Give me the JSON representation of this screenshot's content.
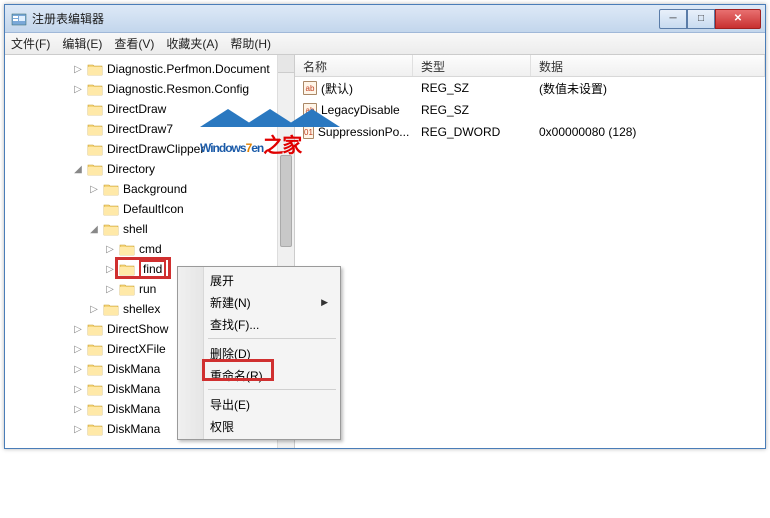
{
  "window": {
    "title": "注册表编辑器"
  },
  "menu": {
    "file": "文件(F)",
    "edit": "编辑(E)",
    "view": "查看(V)",
    "favorites": "收藏夹(A)",
    "help": "帮助(H)"
  },
  "tree": {
    "items": [
      {
        "depth": 3,
        "tw": "▷",
        "label": "Diagnostic.Perfmon.Document"
      },
      {
        "depth": 3,
        "tw": "▷",
        "label": "Diagnostic.Resmon.Config"
      },
      {
        "depth": 3,
        "tw": "",
        "label": "DirectDraw"
      },
      {
        "depth": 3,
        "tw": "",
        "label": "DirectDraw7"
      },
      {
        "depth": 3,
        "tw": "",
        "label": "DirectDrawClipper"
      },
      {
        "depth": 3,
        "tw": "◢",
        "label": "Directory"
      },
      {
        "depth": 4,
        "tw": "▷",
        "label": "Background"
      },
      {
        "depth": 4,
        "tw": "",
        "label": "DefaultIcon"
      },
      {
        "depth": 4,
        "tw": "◢",
        "label": "shell"
      },
      {
        "depth": 5,
        "tw": "▷",
        "label": "cmd"
      },
      {
        "depth": 5,
        "tw": "▷",
        "label": "find",
        "selected": true
      },
      {
        "depth": 5,
        "tw": "▷",
        "label": "run"
      },
      {
        "depth": 4,
        "tw": "▷",
        "label": "shellex"
      },
      {
        "depth": 3,
        "tw": "▷",
        "label": "DirectShow"
      },
      {
        "depth": 3,
        "tw": "▷",
        "label": "DirectXFile"
      },
      {
        "depth": 3,
        "tw": "▷",
        "label": "DiskMana"
      },
      {
        "depth": 3,
        "tw": "▷",
        "label": "DiskMana"
      },
      {
        "depth": 3,
        "tw": "▷",
        "label": "DiskMana"
      },
      {
        "depth": 3,
        "tw": "▷",
        "label": "DiskMana"
      }
    ]
  },
  "list": {
    "headers": {
      "name": "名称",
      "type": "类型",
      "data": "数据"
    },
    "rows": [
      {
        "icon": "ab",
        "name": "(默认)",
        "type": "REG_SZ",
        "data": "(数值未设置)"
      },
      {
        "icon": "ab",
        "name": "LegacyDisable",
        "type": "REG_SZ",
        "data": ""
      },
      {
        "icon": "01",
        "name": "SuppressionPo...",
        "type": "REG_DWORD",
        "data": "0x00000080 (128)"
      }
    ]
  },
  "context_menu": {
    "expand": "展开",
    "new": "新建(N)",
    "find": "查找(F)...",
    "delete": "删除(D)",
    "rename": "重命名(R)",
    "export": "导出(E)",
    "permissions": "权限"
  },
  "watermark": {
    "brand_a": "Windows",
    "brand_b": "7",
    "brand_c": "en",
    "cn": "之家"
  }
}
